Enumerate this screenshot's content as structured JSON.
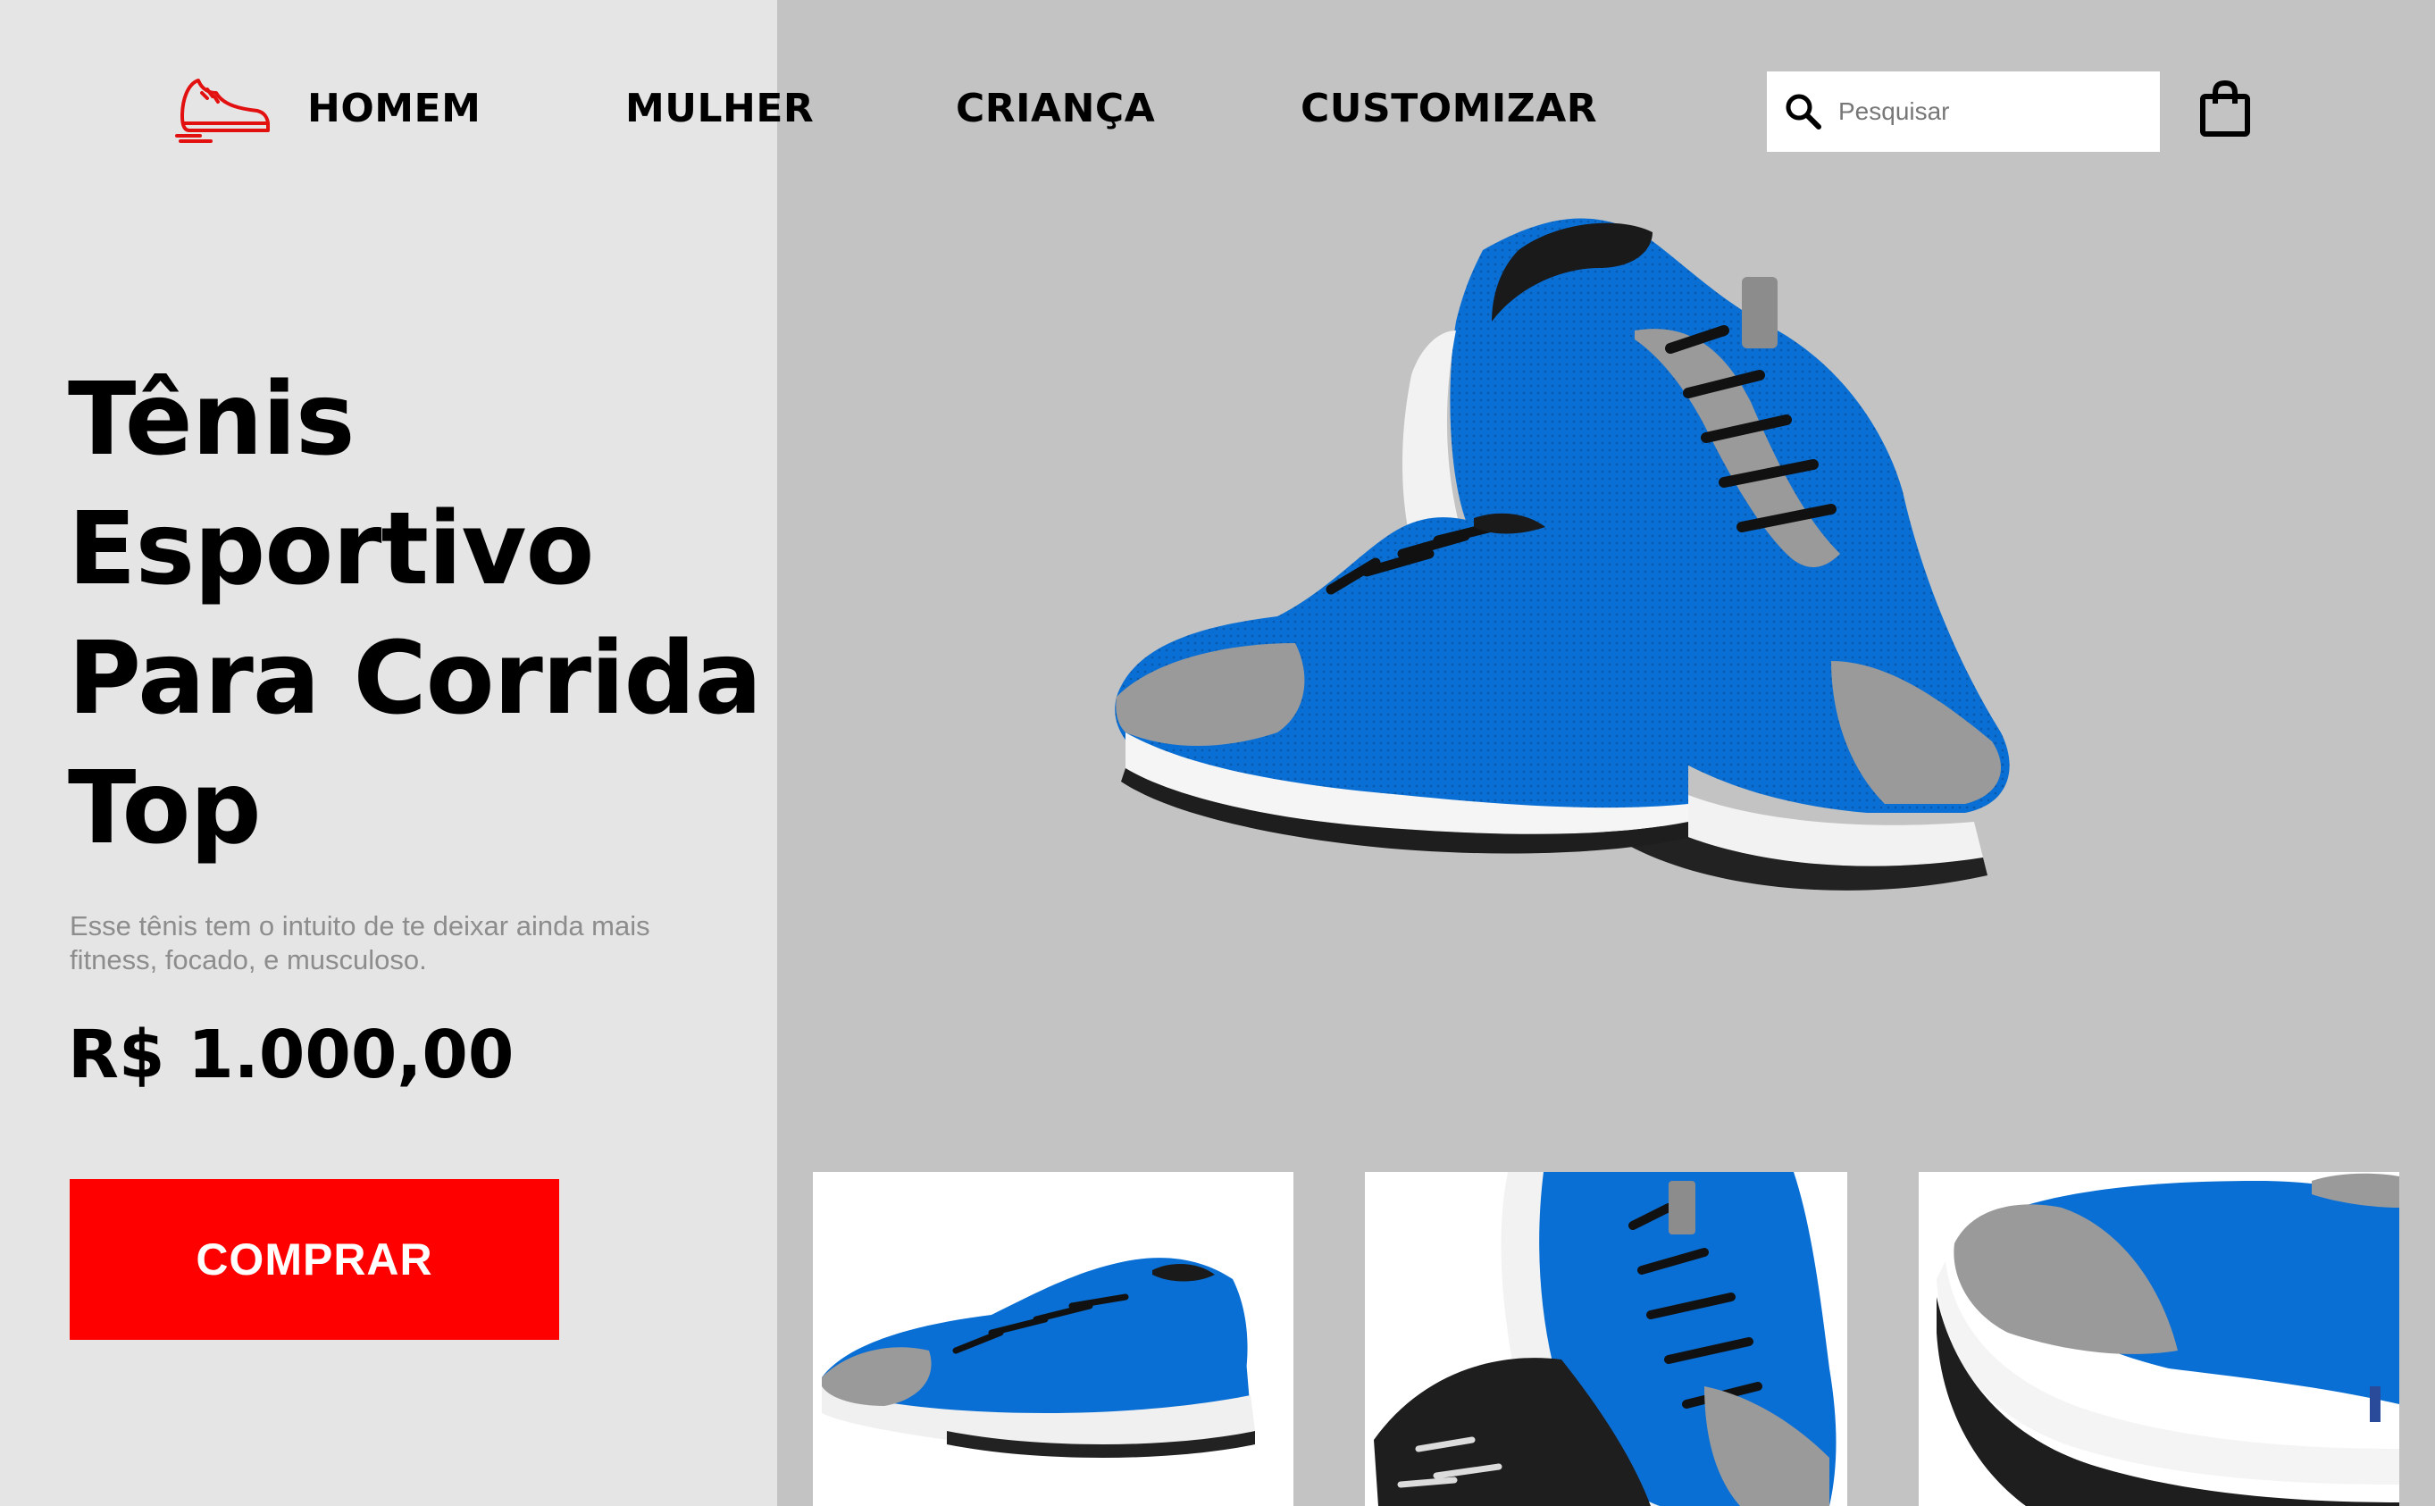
{
  "nav": {
    "items": [
      {
        "label": "HOMEM"
      },
      {
        "label": "MULHER"
      },
      {
        "label": "CRIANÇA"
      },
      {
        "label": "CUSTOMIZAR"
      }
    ]
  },
  "search": {
    "placeholder": "Pesquisar",
    "value": ""
  },
  "icons": {
    "logo": "running-shoe-icon",
    "search": "search-icon",
    "cart": "shopping-bag-icon"
  },
  "product": {
    "title_lines": [
      "Tênis",
      "Esportivo",
      "Para Corrida",
      "Top"
    ],
    "description_lines": [
      "Esse tênis tem o intuito de te deixar ainda mais",
      "fitness, focado, e musculoso."
    ],
    "price": "R$ 1.000,00"
  },
  "actions": {
    "buy_label": "COMPRAR"
  },
  "colors": {
    "accent": "#ff0000",
    "left_bg": "#e5e5e5",
    "right_bg": "#c3c3c3",
    "shoe_blue": "#0a6fd4",
    "shoe_gray": "#9a9a9a"
  }
}
